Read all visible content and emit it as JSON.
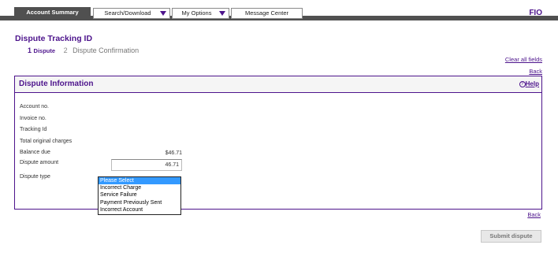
{
  "nav": {
    "tabs": [
      {
        "label": "Account Summary",
        "active": true
      },
      {
        "label": "Search/Download",
        "dropdown": true
      },
      {
        "label": "My Options",
        "dropdown": true
      },
      {
        "label": "Message Center"
      }
    ],
    "brand": "FIO"
  },
  "page": {
    "title": "Dispute Tracking ID",
    "steps": [
      {
        "num": "1",
        "label": "Dispute",
        "active": true
      },
      {
        "num": "2",
        "label": "Dispute Confirmation",
        "active": false
      }
    ],
    "clear_all": "Clear all fields",
    "back_top": "Back",
    "back_bottom": "Back"
  },
  "panel": {
    "title": "Dispute Information",
    "help_icon": "?",
    "help": "Help",
    "fields": {
      "account_no": "Account no.",
      "invoice_no": "Invoice no.",
      "tracking_id": "Tracking Id",
      "total_charges": "Total original charges",
      "balance_due": "Balance due",
      "balance_value": "$46.71",
      "dispute_amount": "Dispute amount",
      "dispute_amount_value": "46.71",
      "dispute_type": "Dispute type"
    },
    "dispute_type_options": [
      "Please Select",
      "Incorrect Charge",
      "Service Failure",
      "Payment Previously Sent",
      "Incorrect Account"
    ]
  },
  "actions": {
    "submit": "Submit dispute"
  },
  "colors": {
    "brand": "#4d148c",
    "nav_bar": "#505050",
    "selected": "#3399ff"
  }
}
